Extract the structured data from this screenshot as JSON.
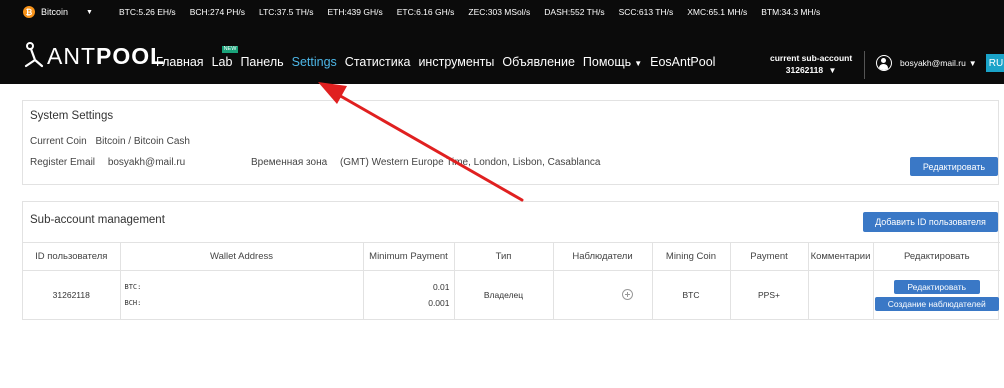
{
  "ticker": {
    "coin": "Bitcoin",
    "items": [
      "BTC:5.26 EH/s",
      "BCH:274 PH/s",
      "LTC:37.5 TH/s",
      "ETH:439 GH/s",
      "ETC:6.16 GH/s",
      "ZEC:303 MSol/s",
      "DASH:552 TH/s",
      "SCC:613 TH/s",
      "XMC:65.1 MH/s",
      "BTM:34.3 MH/s"
    ]
  },
  "logo": {
    "ant": "ANT",
    "pool": "POOL"
  },
  "menu": {
    "home": "Главная",
    "lab": "Lab",
    "lab_badge": "NEW",
    "panel": "Панель",
    "settings": "Settings",
    "stats": "Статистика",
    "tools": "инструменты",
    "announce": "Объявление",
    "help": "Помощь",
    "eos": "EosAntPool"
  },
  "subaccount": {
    "label": "current sub-account",
    "value": "31262118"
  },
  "user": {
    "email": "bosyakh@mail.ru",
    "lang": "RU"
  },
  "system": {
    "title": "System Settings",
    "coin_label": "Current Coin",
    "coin_value": "Bitcoin / Bitcoin Cash",
    "email_label": "Register Email",
    "email_value": "bosyakh@mail.ru",
    "tz_label": "Временная зона",
    "tz_value": "(GMT) Western Europe Time, London, Lisbon, Casablanca",
    "edit_button": "Редактировать"
  },
  "subaccounts": {
    "title": "Sub-account management",
    "add_button": "Добавить ID пользователя",
    "headers": [
      "ID пользователя",
      "Wallet Address",
      "Minimum Payment",
      "Тип",
      "Наблюдатели",
      "Mining Coin",
      "Payment",
      "Комментарии",
      "Редактировать"
    ],
    "rows": [
      {
        "id": "31262118",
        "wallet_btc": "BTC:",
        "wallet_bch": "BCH:",
        "min_btc": "0.01",
        "min_bch": "0.001",
        "type": "Владелец",
        "coin": "BTC",
        "payment": "PPS+",
        "comment": "",
        "edit_button": "Редактировать",
        "watchers_button": "Создание наблюдателей"
      }
    ]
  },
  "colors": {
    "accent": "#3a78c6",
    "active_link": "#4db6e6",
    "arrow": "#e02020"
  }
}
